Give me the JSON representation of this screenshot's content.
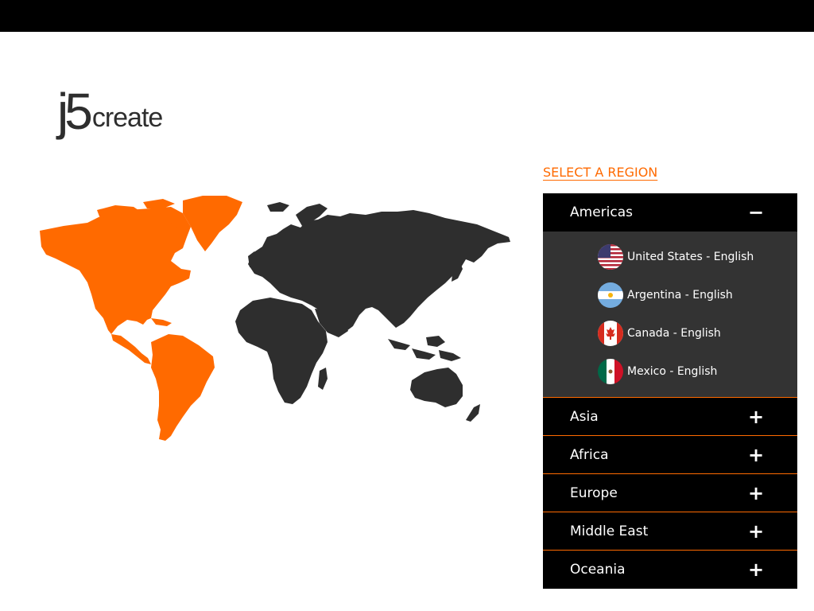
{
  "logo": {
    "part1": "j5",
    "part2": "create"
  },
  "region_heading": "SELECT A REGION",
  "colors": {
    "accent": "#ff6a00",
    "map_dark": "#2e2e2e",
    "panel_bg": "#000000",
    "submenu_bg": "#333333"
  },
  "regions": [
    {
      "name": "Americas",
      "expanded": true,
      "toggle_icon": "minus-icon",
      "toggle": "−",
      "countries": [
        {
          "label": "United States - English",
          "flag_icon": "us-flag-icon"
        },
        {
          "label": "Argentina - English",
          "flag_icon": "argentina-flag-icon"
        },
        {
          "label": "Canada - English",
          "flag_icon": "canada-flag-icon"
        },
        {
          "label": "Mexico - English",
          "flag_icon": "mexico-flag-icon"
        }
      ]
    },
    {
      "name": "Asia",
      "expanded": false,
      "toggle_icon": "plus-icon",
      "toggle": "+"
    },
    {
      "name": "Africa",
      "expanded": false,
      "toggle_icon": "plus-icon",
      "toggle": "+"
    },
    {
      "name": "Europe",
      "expanded": false,
      "toggle_icon": "plus-icon",
      "toggle": "+"
    },
    {
      "name": "Middle East",
      "expanded": false,
      "toggle_icon": "plus-icon",
      "toggle": "+"
    },
    {
      "name": "Oceania",
      "expanded": false,
      "toggle_icon": "plus-icon",
      "toggle": "+"
    }
  ]
}
